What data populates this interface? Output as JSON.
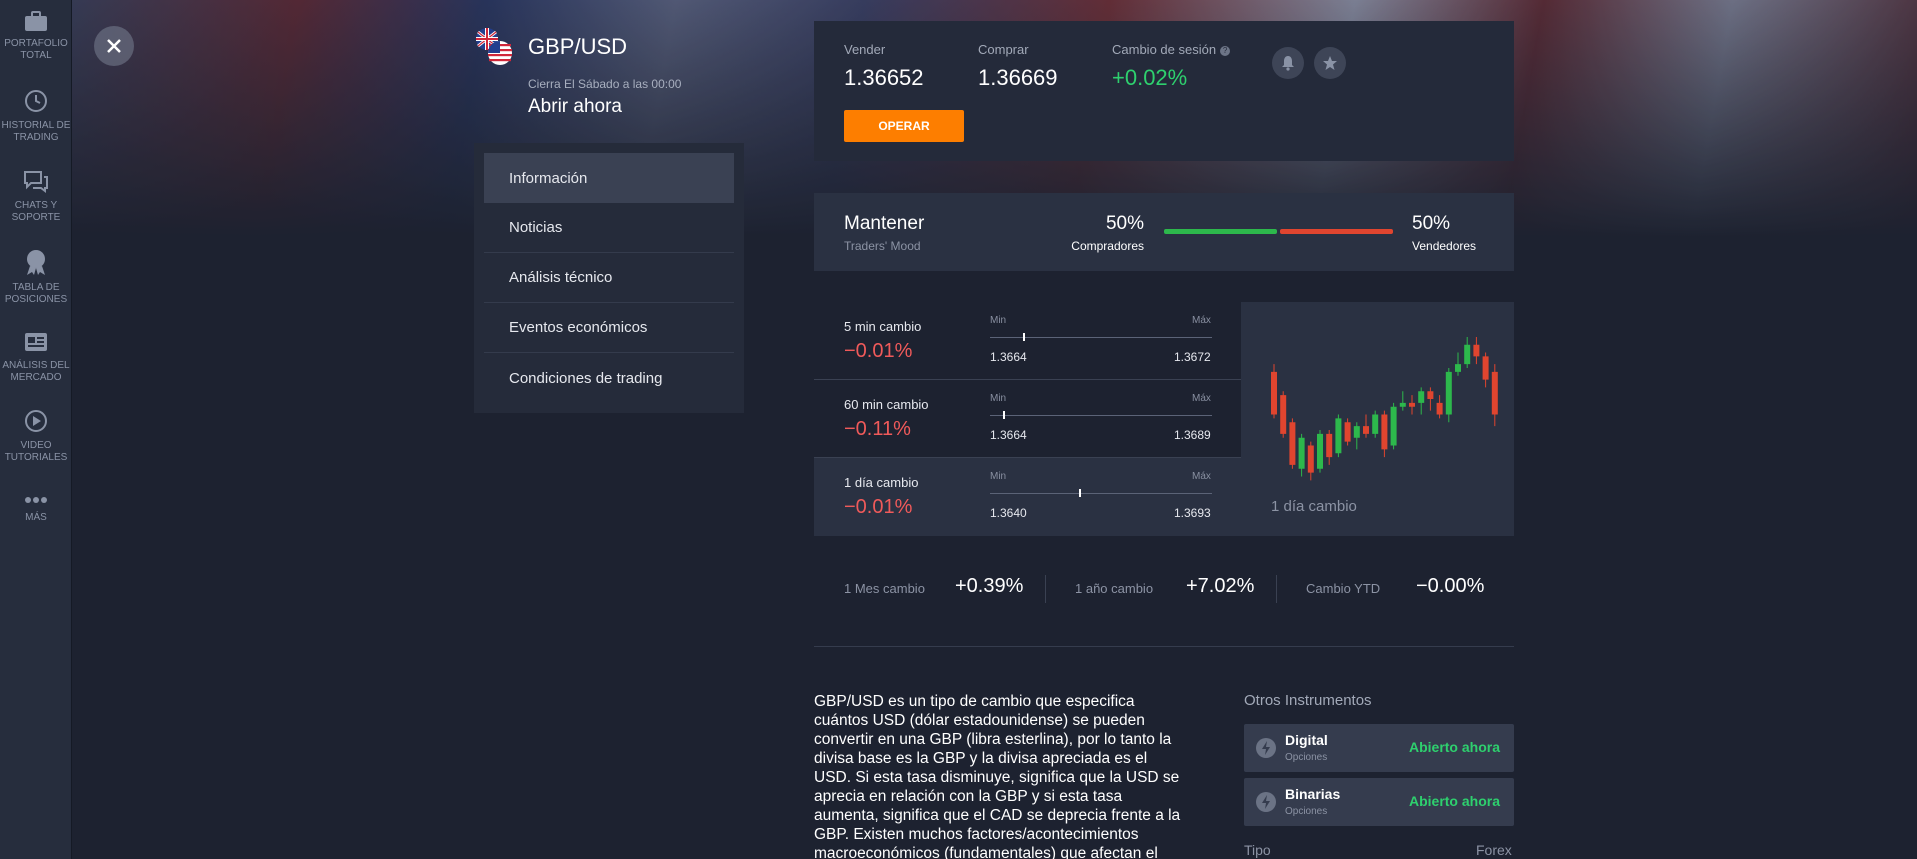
{
  "nav": {
    "items": [
      {
        "label": "PORTAFOLIO TOTAL",
        "icon": "briefcase-icon"
      },
      {
        "label": "HISTORIAL DE TRADING",
        "icon": "history-icon"
      },
      {
        "label": "CHATS Y SOPORTE",
        "icon": "chat-icon"
      },
      {
        "label": "TABLA DE POSICIONES",
        "icon": "award-icon"
      },
      {
        "label": "ANÁLISIS DEL MERCADO",
        "icon": "news-icon"
      },
      {
        "label": "VIDEO TUTORIALES",
        "icon": "play-icon"
      },
      {
        "label": "MÁS",
        "icon": "more-icon"
      }
    ]
  },
  "asset": {
    "title": "GBP/USD",
    "close_note": "Cierra El Sábado a las 00:00",
    "status": "Abrir ahora"
  },
  "tabs": [
    {
      "label": "Información",
      "active": true
    },
    {
      "label": "Noticias"
    },
    {
      "label": "Análisis técnico"
    },
    {
      "label": "Eventos económicos"
    },
    {
      "label": "Condiciones de trading"
    }
  ],
  "quote": {
    "sell_label": "Vender",
    "sell_value": "1.36652",
    "buy_label": "Comprar",
    "buy_value": "1.36669",
    "session_label": "Cambio de sesión",
    "session_value": "+0.02%",
    "operate_label": "OPERAR"
  },
  "mood": {
    "title": "Mantener",
    "subtitle": "Traders' Mood",
    "buyers_pct": "50%",
    "buyers_label": "Compradores",
    "sellers_pct": "50%",
    "sellers_label": "Vendedores",
    "buyers_fraction": 0.5
  },
  "changes": [
    {
      "label": "5 min cambio",
      "value": "−0.01%",
      "min_label": "Min",
      "max_label": "Máx",
      "min": "1.3664",
      "max": "1.3672",
      "position": 0.15
    },
    {
      "label": "60 min cambio",
      "value": "−0.11%",
      "min_label": "Min",
      "max_label": "Máx",
      "min": "1.3664",
      "max": "1.3689",
      "position": 0.06
    },
    {
      "label": "1 día cambio",
      "value": "−0.01%",
      "min_label": "Min",
      "max_label": "Máx",
      "min": "1.3640",
      "max": "1.3693",
      "position": 0.4
    }
  ],
  "candle_caption": "1 día cambio",
  "candles": [
    {
      "o": 62,
      "c": 40,
      "h": 66,
      "l": 38
    },
    {
      "o": 50,
      "c": 30,
      "h": 52,
      "l": 28
    },
    {
      "o": 36,
      "c": 14,
      "h": 38,
      "l": 12
    },
    {
      "o": 12,
      "c": 28,
      "h": 30,
      "l": 8
    },
    {
      "o": 24,
      "c": 10,
      "h": 26,
      "l": 6
    },
    {
      "o": 12,
      "c": 30,
      "h": 32,
      "l": 10
    },
    {
      "o": 30,
      "c": 18,
      "h": 32,
      "l": 14
    },
    {
      "o": 20,
      "c": 38,
      "h": 40,
      "l": 18
    },
    {
      "o": 36,
      "c": 26,
      "h": 38,
      "l": 24
    },
    {
      "o": 28,
      "c": 34,
      "h": 36,
      "l": 22
    },
    {
      "o": 34,
      "c": 30,
      "h": 40,
      "l": 28
    },
    {
      "o": 30,
      "c": 40,
      "h": 42,
      "l": 28
    },
    {
      "o": 40,
      "c": 22,
      "h": 42,
      "l": 18
    },
    {
      "o": 24,
      "c": 44,
      "h": 46,
      "l": 22
    },
    {
      "o": 44,
      "c": 46,
      "h": 52,
      "l": 42
    },
    {
      "o": 46,
      "c": 44,
      "h": 50,
      "l": 40
    },
    {
      "o": 46,
      "c": 52,
      "h": 54,
      "l": 40
    },
    {
      "o": 52,
      "c": 48,
      "h": 54,
      "l": 42
    },
    {
      "o": 46,
      "c": 40,
      "h": 50,
      "l": 38
    },
    {
      "o": 40,
      "c": 62,
      "h": 64,
      "l": 36
    },
    {
      "o": 62,
      "c": 66,
      "h": 72,
      "l": 60
    },
    {
      "o": 66,
      "c": 76,
      "h": 80,
      "l": 64
    },
    {
      "o": 76,
      "c": 70,
      "h": 80,
      "l": 66
    },
    {
      "o": 70,
      "c": 58,
      "h": 72,
      "l": 54
    },
    {
      "o": 62,
      "c": 40,
      "h": 66,
      "l": 34
    }
  ],
  "stats": [
    {
      "label": "1 Mes cambio",
      "value": "+0.39%"
    },
    {
      "label": "1 año cambio",
      "value": "+7.02%"
    },
    {
      "label": "Cambio YTD",
      "value": "−0.00%"
    }
  ],
  "description": "GBP/USD es un tipo de cambio que especifica cuántos USD (dólar estadounidense) se pueden convertir en una GBP (libra esterlina), por lo tanto la divisa base es la GBP y la divisa apreciada es el USD. Si esta tasa disminuye, significa que la USD se aprecia en relación con la GBP y si esta tasa aumenta, significa que el CAD se deprecia frente a la GBP. Existen muchos factores/acontecimientos macroeconómicos (fundamentales) que afectan el",
  "others": {
    "title": "Otros Instrumentos",
    "items": [
      {
        "name": "Digital",
        "sub": "Opciones",
        "status": "Abierto ahora"
      },
      {
        "name": "Binarias",
        "sub": "Opciones",
        "status": "Abierto ahora"
      }
    ],
    "type_label": "Tipo",
    "type_value": "Forex"
  },
  "colors": {
    "accent_orange": "#fd7e00",
    "positive": "#2ed06e",
    "negative": "#f05a5a",
    "candle_up": "#2db84c",
    "candle_down": "#e0452f"
  }
}
